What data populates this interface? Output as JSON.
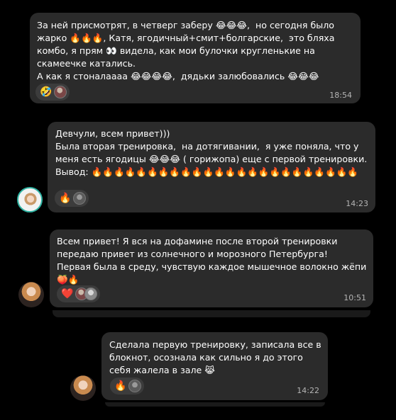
{
  "messages": [
    {
      "text": "За ней присмотрят, в четверг заберу 😂😂😂,  но сегодня было жарко 🔥🔥🔥, Катя, ягодичный+смит+болгарские,  это бляха комбо, я прям 👀 видела, как мои булочки кругленькие на скамеечке катались.\nА как я стоналаааа 😂😂😂😂,  дядьки залюбовались 😂😂😂",
      "reactions": [
        "🤣"
      ],
      "time": "18:54"
    },
    {
      "text": "Девчули, всем привет)))\nБыла вторая тренировка,  на дотягивании,  я уже поняла, что у меня есть ягодицы 😂😂😂 ( горижопа) еще с первой тренировки.\nВывод: 🔥🔥🔥🔥🔥🔥🔥🔥🔥🔥🔥🔥🔥🔥🔥🔥🔥🔥🔥🔥🔥🔥🔥🔥",
      "reactions": [
        "🔥"
      ],
      "time": "14:23"
    },
    {
      "text": "Всем привет! Я вся на дофамине после второй тренировки передаю привет из солнечного и морозного Петербурга!\nПервая была в среду, чувствую каждое мышечное волокно жёпи 🍑🔥",
      "reactions": [
        "❤️"
      ],
      "time": "10:51"
    },
    {
      "text": "Сделала первую тренировку, записала все в блокнот, осознала как сильно я до этого себя жалела в зале 😹",
      "reactions": [
        "🔥"
      ],
      "time": "14:22"
    }
  ]
}
